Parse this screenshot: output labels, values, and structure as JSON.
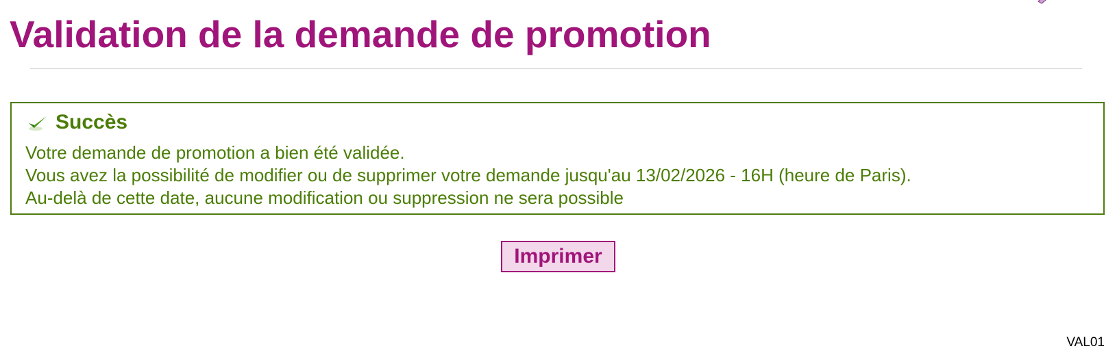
{
  "header": {
    "title": "Validation de la demande de promotion"
  },
  "success": {
    "title": "Succès",
    "lines": [
      "Votre demande de promotion a bien été validée.",
      "Vous avez la possibilité de modifier ou de supprimer votre demande jusqu'au 13/02/2026 - 16H (heure de Paris).",
      "Au-delà de cette date, aucune modification ou suppression ne sera possible"
    ]
  },
  "actions": {
    "print_label": "Imprimer"
  },
  "footer": {
    "page_code": "VAL01"
  },
  "icons": {
    "success": "check-icon",
    "top_corner": "pencil-icon"
  },
  "colors": {
    "title": "#a0157a",
    "success_text": "#4b7d06",
    "success_border": "#4e7b0e",
    "button_bg": "#f3d7ea",
    "rule": "#cfcfcf"
  }
}
